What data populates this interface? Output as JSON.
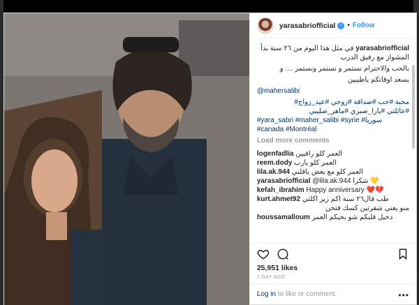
{
  "post": {
    "username": "yarasabriofficial",
    "follow_label": "Follow",
    "caption": {
      "username": "yarasabriofficial",
      "line1": "في مثل هذا اليوم من ٢٦ سنة بدأ المشوار مع رفيق الدرب",
      "line2": "بالحب والاحترام نستمر و نستمر ونستمر .... و",
      "line3": "يسعد اوقاتكم ياطيبين",
      "mention": "@mahersalibi",
      "tags1": "محبة #حب #صداقة #زوجي #عيد_زواج#",
      "tags2": "#عائلتي #يارا_صبري #ماهر_صليبي",
      "tags3": "#yara_sabri #maher_salibi #syrie #سوريا",
      "tags4": "#canada #Montréal"
    },
    "load_more_label": "Load more comments",
    "comments": [
      {
        "user": "logenfadlia",
        "text": "العمر كلو راقيين",
        "rtl": true
      },
      {
        "user": "reem.dody",
        "text": "العمر كلو يارب",
        "rtl": true
      },
      {
        "user": "lila.ak.944",
        "text": "العمر كلو مع بعض ياقلبي",
        "rtl": true
      },
      {
        "user": "yarasabriofficial",
        "text": "@lila.ak.944 شكرا 💛",
        "rtl": false
      },
      {
        "user": "kefah_ibrahim",
        "text": "Happy anniversary ❤️💔",
        "rtl": false
      },
      {
        "user": "kurt.ahmet92",
        "text": "طب قال٢٦ سنة اكم زير اكلتي",
        "rtl": true
      },
      {
        "user": "",
        "text": "منو يعني شفرتين كسك فتحن",
        "rtl": true
      },
      {
        "user": "houssamalloum",
        "text": "دخيل قلبكم شو بحبكم العمر",
        "rtl": true
      }
    ],
    "likes": "25,951 likes",
    "timestamp": "1 DAY AGO",
    "login_link": "Log in",
    "login_text": "to like or comment."
  },
  "icons": {
    "verified": "verified-badge-icon",
    "like": "heart-icon",
    "comment": "comment-icon",
    "bookmark": "bookmark-icon"
  },
  "colors": {
    "link": "#003569",
    "accent": "#3897f0"
  }
}
